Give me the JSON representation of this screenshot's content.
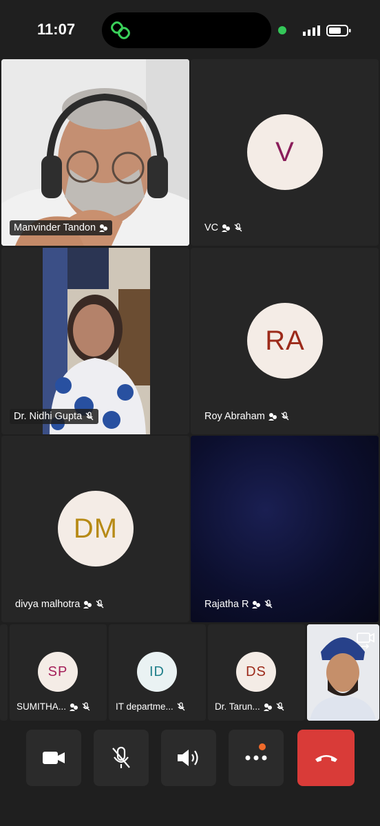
{
  "status_bar": {
    "time": "11:07"
  },
  "tiles": [
    {
      "name": "Manvinder Tandon"
    },
    {
      "name": "VC",
      "initials": "V",
      "color": "#8a1d5a"
    },
    {
      "name": "Dr. Nidhi Gupta"
    },
    {
      "name": "Roy Abraham",
      "initials": "RA",
      "color": "#9c2a1a"
    },
    {
      "name": "divya malhotra",
      "initials": "DM",
      "color": "#b78a15"
    },
    {
      "name": "Rajatha R"
    }
  ],
  "strip": [
    {
      "name": "SUMITHA...",
      "initials": "SP",
      "color": "#a5205a"
    },
    {
      "name": "IT departme...",
      "initials": "ID",
      "color": "#1f7f8a"
    },
    {
      "name": "Dr. Tarun...",
      "initials": "DS",
      "color": "#9c2a1a"
    }
  ],
  "controls": {
    "camera": "camera-icon",
    "mic": "mic-off-icon",
    "speaker": "speaker-icon",
    "more": "more-icon",
    "end": "end-call-icon",
    "end_color": "#d93b38"
  }
}
